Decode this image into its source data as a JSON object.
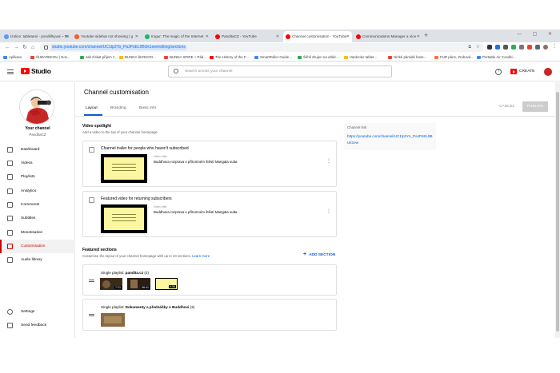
{
  "browser": {
    "tabs": [
      {
        "label": "Izolice: tabletami - pondělkyval ~ Wi",
        "fav": "#5e97f6"
      },
      {
        "label": "Youtube sidebar not showing | g",
        "fav": "#ff5722"
      },
      {
        "label": "Imgur: The magic of the Internet",
        "fav": "#1bb76e"
      },
      {
        "label": "PanditaCZ - YouTube",
        "fav": "#ff0000"
      },
      {
        "label": "Channel customisation - YouTube",
        "fav": "#ff0000"
      },
      {
        "label": "Communications Manager a více",
        "fav": "#ff0000"
      }
    ],
    "new_tab_label": "+",
    "window_controls": "— ▢ ✕",
    "url": "studio.youtube.com/channel/UC1tp2Yo_PaJPsEL9BUk1ew/editing/sections",
    "bookmarks": [
      {
        "label": "Aplikace",
        "color": "#4285f4"
      },
      {
        "label": "ŠUBAREKOU | Nov...",
        "color": "#ea4335"
      },
      {
        "label": "Jak získat přijem z...",
        "color": "#34a853"
      },
      {
        "label": "BUNDA ŠKRKOO...",
        "color": "#fbbc05"
      },
      {
        "label": "BUNDA SPIRE + Pád...",
        "color": "#ea4335"
      },
      {
        "label": "The History of the F...",
        "color": "#ff0000"
      },
      {
        "label": "SmartRoller Guide...",
        "color": "#4285f4"
      },
      {
        "label": "Šéhil zkujen na obléc...",
        "color": "#34a853"
      },
      {
        "label": "Vardooko tablet...",
        "color": "#fbbc05"
      },
      {
        "label": "Nízké pámidé bose...",
        "color": "#ea4335"
      },
      {
        "label": "FUR páns, Zrubová...",
        "color": "#ff7043"
      },
      {
        "label": "Portable Air Conditi...",
        "color": "#4285f4"
      }
    ]
  },
  "header": {
    "app_name": "Studio",
    "search_placeholder": "Search across your channel",
    "help_glyph": "?",
    "create_label": "CREATE"
  },
  "sidebar": {
    "your_channel": "Your channel",
    "channel_name": "PanditaCZ",
    "items": [
      {
        "label": "Dashboard"
      },
      {
        "label": "Videos"
      },
      {
        "label": "Playlists"
      },
      {
        "label": "Analytics"
      },
      {
        "label": "Comments"
      },
      {
        "label": "Subtitles"
      },
      {
        "label": "Monetisation"
      },
      {
        "label": "Customisation"
      },
      {
        "label": "Audio library"
      }
    ],
    "bottom_items": [
      {
        "label": "Settings"
      },
      {
        "label": "Send feedback"
      }
    ]
  },
  "main": {
    "title": "Channel customisation",
    "tabs": [
      {
        "label": "Layout"
      },
      {
        "label": "Branding"
      },
      {
        "label": "Basic info"
      }
    ],
    "cancel_label": "CANCEL",
    "publish_label": "PUBLISH",
    "video_spotlight": {
      "heading": "Video spotlight",
      "description": "Add a video to the top of your channel homepage",
      "trailer": {
        "title": "Channel trailer for people who haven't subscribed",
        "video_label": "Video title",
        "video_title": "Buddhova rozprava o přítomném štěstí Mangala sutta"
      },
      "featured": {
        "title": "Featured video for returning subscribers",
        "video_label": "Video title",
        "video_title": "Buddhova rozprava o přítomném štěstí Mangala sutta"
      }
    },
    "featured_sections": {
      "heading": "Featured sections",
      "description": "Customise the layout of your channel homepage with up to 10 sections.",
      "learn_more": "Learn more",
      "add_section_label": "ADD SECTION",
      "sections": [
        {
          "prefix": "Single playlist:",
          "name": "pandita.cz",
          "count": "(3)",
          "durations": [
            "7:21",
            "58:41",
            "9:56"
          ]
        },
        {
          "prefix": "Single playlist:",
          "name": "Dokumenty a přednášky o Buddhovi",
          "count": "(3)"
        }
      ]
    },
    "channel_link": {
      "label": "Channel link",
      "url": "https://youtube.com/channel/UC1tp2Yo_PaJPsEL9BUk1ew"
    }
  }
}
